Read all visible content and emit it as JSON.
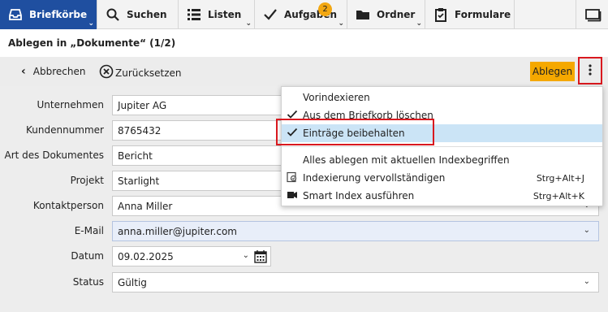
{
  "nav": {
    "items": [
      {
        "label": "Briefkörbe",
        "icon": "inbox-icon"
      },
      {
        "label": "Suchen",
        "icon": "search-icon"
      },
      {
        "label": "Listen",
        "icon": "list-icon"
      },
      {
        "label": "Aufgaben",
        "icon": "checkmark-icon",
        "badge": "2"
      },
      {
        "label": "Ordner",
        "icon": "folder-icon"
      },
      {
        "label": "Formulare",
        "icon": "clipboard-icon"
      }
    ],
    "window_icon": "window-icon"
  },
  "title": "Ablegen in „Dokumente“ (1/2)",
  "actions": {
    "cancel": "Abbrechen",
    "reset": "Zurücksetzen",
    "file": "Ablegen"
  },
  "form": {
    "fields": [
      {
        "label": "Unternehmen",
        "value": "Jupiter AG"
      },
      {
        "label": "Kundennummer",
        "value": "8765432"
      },
      {
        "label": "Art des Dokumentes",
        "value": "Bericht"
      },
      {
        "label": "Projekt",
        "value": "Starlight"
      },
      {
        "label": "Kontaktperson",
        "value": "Anna Miller"
      },
      {
        "label": "E-Mail",
        "value": "anna.miller@jupiter.com"
      },
      {
        "label": "Datum",
        "value": "09.02.2025"
      },
      {
        "label": "Status",
        "value": "Gültig"
      }
    ]
  },
  "menu": {
    "items": [
      {
        "label": "Vorindexieren",
        "checked": false,
        "shortcut": ""
      },
      {
        "label": "Aus dem Briefkorb löschen",
        "checked": true,
        "shortcut": ""
      },
      {
        "label": "Einträge beibehalten",
        "checked": true,
        "shortcut": ""
      },
      {
        "label": "Alles ablegen mit aktuellen Indexbegriffen",
        "checked": false,
        "shortcut": ""
      },
      {
        "label": "Indexierung vervollständigen",
        "checked": false,
        "shortcut": "Strg+Alt+J"
      },
      {
        "label": "Smart Index ausführen",
        "checked": false,
        "shortcut": "Strg+Alt+K"
      }
    ]
  },
  "colors": {
    "nav_active": "#1f4fa0",
    "accent_button": "#f5a800",
    "badge": "#f2a712",
    "highlight_border": "#d9191f",
    "menu_selected": "#cbe4f6"
  }
}
